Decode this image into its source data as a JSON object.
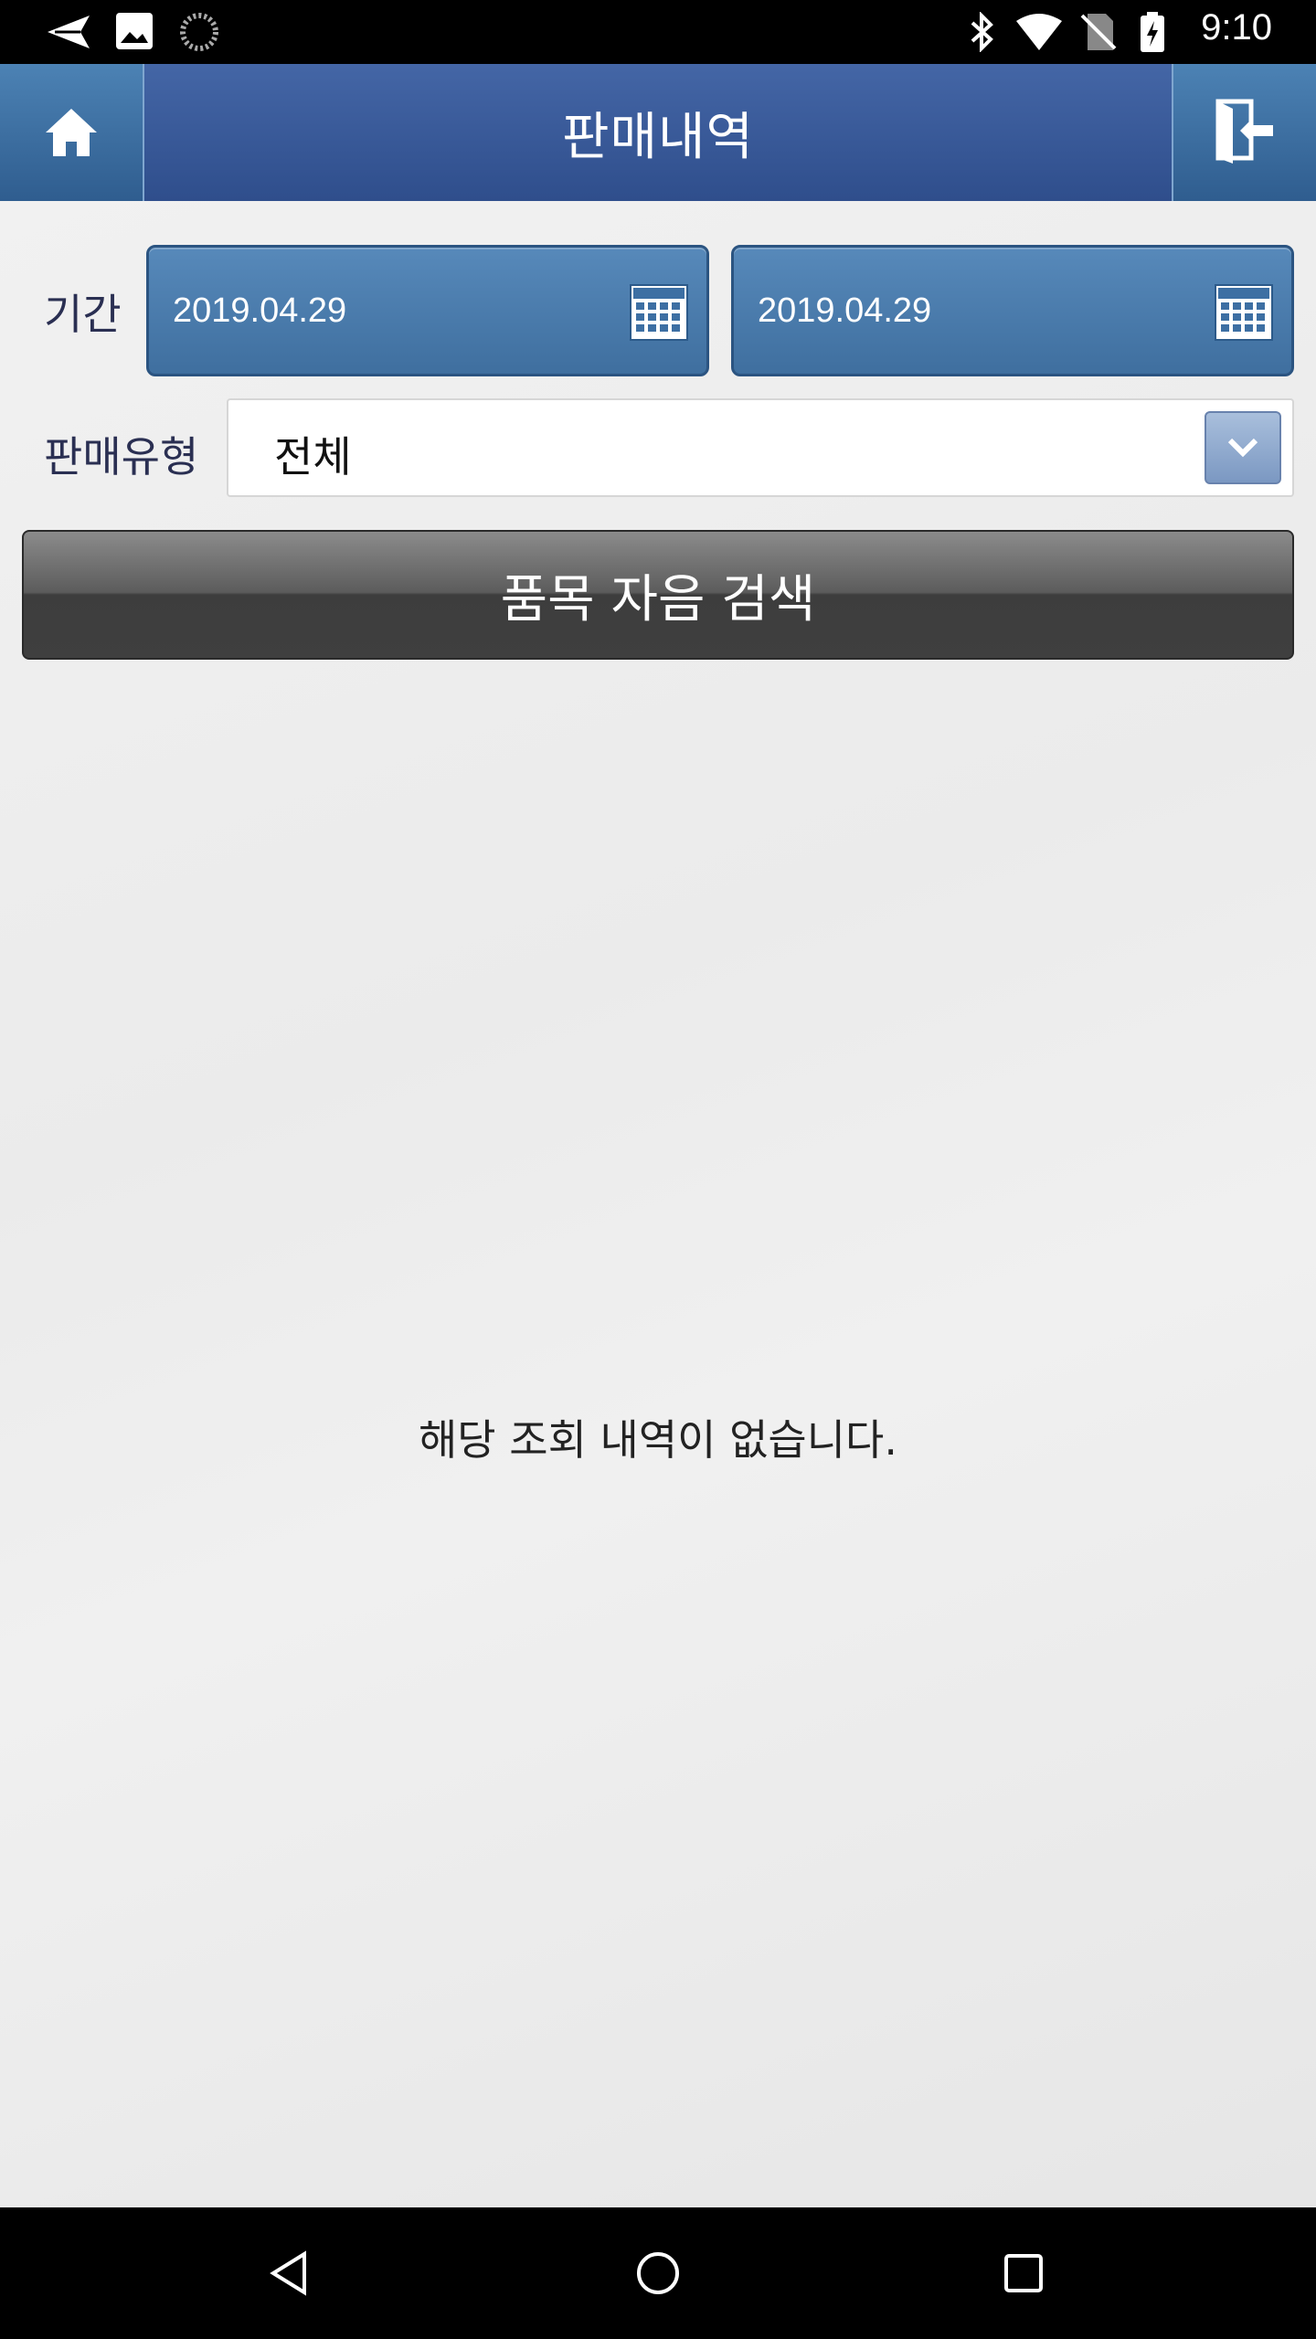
{
  "status_bar": {
    "time": "9:10",
    "left_icons": [
      "send-icon",
      "image-icon",
      "loading-icon"
    ],
    "right_icons": [
      "bluetooth-icon",
      "wifi-icon",
      "no-sim-icon",
      "battery-charging-icon"
    ]
  },
  "header": {
    "title": "판매내역",
    "home_icon": "home-icon",
    "logout_icon": "logout-icon"
  },
  "form": {
    "period_label": "기간",
    "start_date": "2019.04.29",
    "end_date": "2019.04.29",
    "sale_type_label": "판매유형",
    "sale_type_value": "전체"
  },
  "search_button_label": "품목 자음 검색",
  "empty_message": "해당 조회 내역이 없습니다.",
  "nav": {
    "back_icon": "back-triangle-icon",
    "home_icon": "home-circle-icon",
    "recents_icon": "recents-square-icon"
  },
  "colors": {
    "header_blue": "#3a5a9a",
    "date_box_blue": "#4a7cad",
    "button_dark": "#3f3f3f",
    "label_text": "#2a2f52"
  }
}
